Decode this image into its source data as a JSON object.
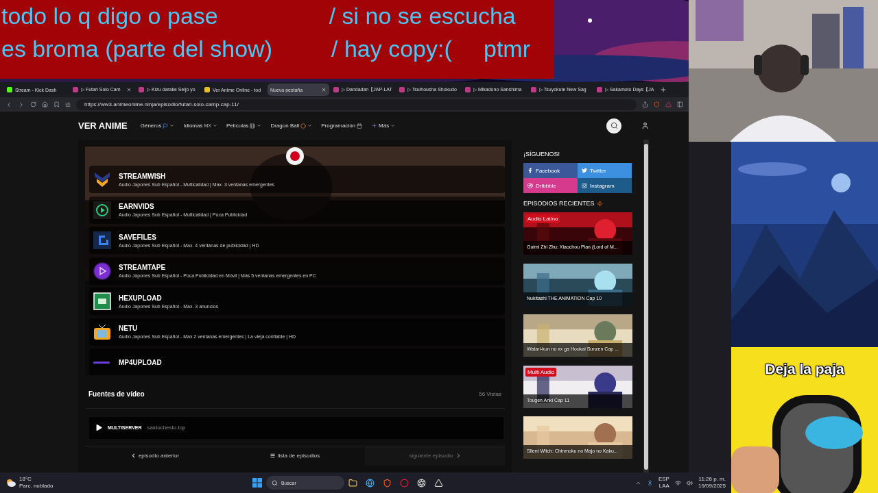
{
  "overlay": {
    "banner_lines": [
      [
        "todo lo q digo o pase",
        "/ si no se escucha"
      ],
      [
        "es broma (parte del show)",
        "/ hay copy:(",
        "ptmr"
      ]
    ],
    "meme_caption": "Deja la paja"
  },
  "browser": {
    "tabs": [
      {
        "title": "Stream - Kick Dash",
        "selected": false,
        "closable": false
      },
      {
        "title": "▷ Futari Solo Cam",
        "selected": false,
        "closable": true
      },
      {
        "title": "▷ Kizu darake Seijo yo",
        "selected": false,
        "closable": false
      },
      {
        "title": "Ver Anime Online - tod",
        "selected": false,
        "closable": false
      },
      {
        "title": "Nueva pestaña",
        "selected": true,
        "closable": true
      },
      {
        "title": "▷ Dandadan【JAP-LAT",
        "selected": false,
        "closable": false
      },
      {
        "title": "▷ Tsuihousha Shokudo",
        "selected": false,
        "closable": false
      },
      {
        "title": "▷ Mikadono Sanshima",
        "selected": false,
        "closable": false
      },
      {
        "title": "▷ Tsuyokute New Sag",
        "selected": false,
        "closable": false
      },
      {
        "title": "▷ Sakamoto Days【JA",
        "selected": false,
        "closable": false
      }
    ],
    "url": "https://ww3.animeonline.ninja/episodio/futari-solo-camp-cap-11/"
  },
  "site": {
    "logo": "VER ANIME",
    "menu": [
      {
        "label": "Géneros",
        "dropdown": true
      },
      {
        "label": "Idiomas",
        "tag": "MX",
        "dropdown": true
      },
      {
        "label": "Películas",
        "dropdown": true
      },
      {
        "label": "Dragon Ball",
        "dropdown": true
      },
      {
        "label": "Programación",
        "dropdown": false
      },
      {
        "label": "Más",
        "dropdown": true
      }
    ],
    "servers": [
      {
        "name": "STREAMWISH",
        "description": "Audio Japones Sub Español - Multicalidad | Max. 3 ventanas emergentes"
      },
      {
        "name": "EARNVIDS",
        "description": "Audio Japones Sub Español - Multicalidad | Poca Publicidad"
      },
      {
        "name": "SAVEFILES",
        "description": "Audio Japones Sub Español - Max. 4 ventanas de publicidad | HD"
      },
      {
        "name": "STREAMTAPE",
        "description": "Audio Japones Sub Español - Poca Publicidad en Móvil | Más 5 ventanas emergentes en PC"
      },
      {
        "name": "HEXUPLOAD",
        "description": "Audio Japones Sub Español - Max. 3 anuncios"
      },
      {
        "name": "NETU",
        "description": "Audio Japones Sub Español - Max 2 ventanas emergentes | La vieja confiable | HD"
      },
      {
        "name": "MP4UPLOAD"
      }
    ],
    "sources": {
      "title": "Fuentes de vídeo",
      "views": "56 Vistas",
      "items": [
        {
          "name": "MULTISERVER",
          "host": "saidochesto.top"
        }
      ]
    },
    "episode_nav": [
      {
        "label": "episodio anterior",
        "disabled": false
      },
      {
        "label": "lista de episodios",
        "disabled": false
      },
      {
        "label": "siguiente episodio",
        "disabled": true
      }
    ],
    "sidebar": {
      "follow_title": "¡SÍGUENOS!",
      "social": [
        {
          "label": "Facebook",
          "kind": "facebook",
          "color": "#3b5998"
        },
        {
          "label": "Twitter",
          "kind": "twitter",
          "color": "#3d8fe0"
        },
        {
          "label": "Dribbble",
          "kind": "dribbble",
          "color": "#d63a8c"
        },
        {
          "label": "Instagram",
          "kind": "instagram",
          "color": "#1d5b8a"
        }
      ],
      "recent_title": "EPISODIOS RECIENTES",
      "episodes": [
        {
          "title": "Guimi Zhi Zhu: Xiaochou Pian (Lord of M...",
          "badge": "Audio Latino"
        },
        {
          "title": "Nukitashi THE ANIMATION Cap 10"
        },
        {
          "title": "Watari-kun no xx ga Houkai Sunzen Cap ..."
        },
        {
          "title": "Tougen Anki Cap 11",
          "badge": "Multi Audio"
        },
        {
          "title": "Silent Witch: Chinmoku no Majo no Kaku..."
        }
      ]
    }
  },
  "taskbar": {
    "weather": {
      "temp": "18°C",
      "condition": "Parc. nublado"
    },
    "search_placeholder": "Buscar",
    "lang": [
      "ESP",
      "LAA"
    ],
    "time": "11:26 p. m.",
    "date": "19/09/2025"
  }
}
